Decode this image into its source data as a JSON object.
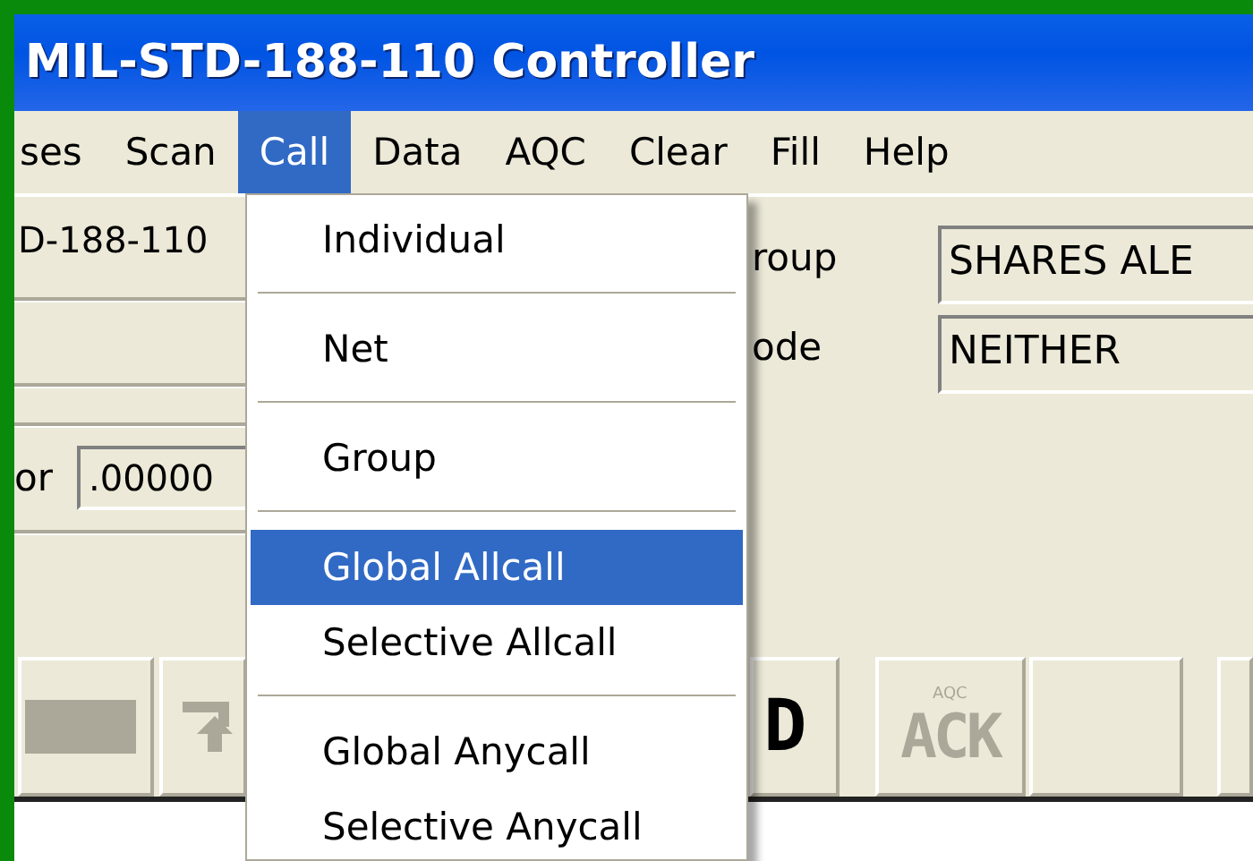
{
  "window": {
    "title": "MIL-STD-188-110 Controller"
  },
  "menu_bar": [
    {
      "label": "ses",
      "selected": false
    },
    {
      "label": "Scan",
      "selected": false
    },
    {
      "label": "Call",
      "selected": true
    },
    {
      "label": "Data",
      "selected": false
    },
    {
      "label": "AQC",
      "selected": false
    },
    {
      "label": "Clear",
      "selected": false
    },
    {
      "label": "Fill",
      "selected": false
    },
    {
      "label": "Help",
      "selected": false
    }
  ],
  "call_menu": [
    {
      "kind": "item",
      "label": "Individual",
      "selected": false
    },
    {
      "kind": "separator"
    },
    {
      "kind": "item",
      "label": "Net",
      "selected": false
    },
    {
      "kind": "separator"
    },
    {
      "kind": "item",
      "label": "Group",
      "selected": false
    },
    {
      "kind": "separator"
    },
    {
      "kind": "item",
      "label": "Global Allcall",
      "selected": true
    },
    {
      "kind": "item",
      "label": "Selective Allcall",
      "selected": false
    },
    {
      "kind": "separator"
    },
    {
      "kind": "item",
      "label": "Global Anycall",
      "selected": false
    },
    {
      "kind": "item",
      "label": "Selective Anycall",
      "selected": false
    }
  ],
  "left_panel": {
    "text": "D-188-110",
    "label": "or",
    "value": ".00000"
  },
  "right_panel": [
    {
      "label": "roup",
      "value": "SHARES ALE"
    },
    {
      "label": "ode",
      "value": "NEITHER"
    }
  ],
  "toolbar": [
    {
      "kind": "bar"
    },
    {
      "kind": "arrow"
    },
    {
      "kind": "text",
      "label": "D"
    },
    {
      "kind": "ack",
      "caption": "AQC",
      "label": "ACK",
      "disabled": true
    },
    {
      "kind": "blank"
    },
    {
      "kind": "blank"
    }
  ]
}
